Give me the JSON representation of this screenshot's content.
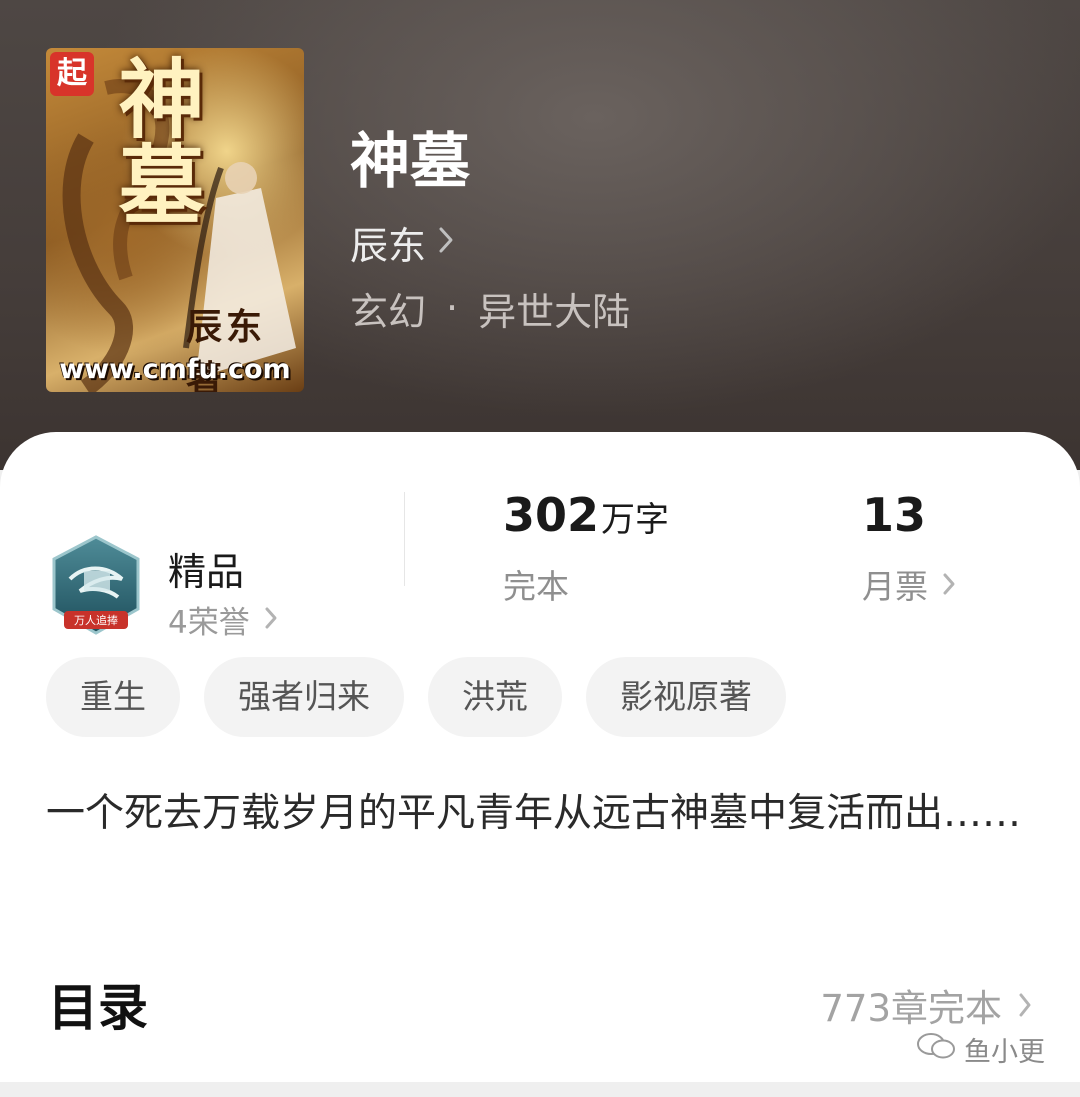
{
  "book": {
    "title": "神墓",
    "author": "辰东",
    "genre": "玄幻",
    "subgenre": "异世大陆",
    "genre_separator": "·"
  },
  "cover": {
    "badge": "起",
    "title": "神墓",
    "author": "辰东著",
    "url": "www.cmfu.com"
  },
  "honor": {
    "name": "精品",
    "count_label": "4荣誉",
    "icon_label": "万人追捧"
  },
  "stats": {
    "word_count": "302",
    "word_unit": "万字",
    "status": "完本",
    "monthly_votes": "13",
    "monthly_votes_label": "月票"
  },
  "tags": [
    "重生",
    "强者归来",
    "洪荒",
    "影视原著"
  ],
  "description": "一个死去万载岁月的平凡青年从远古神墓中复活而出……",
  "toc": {
    "title": "目录",
    "chapter_info": "773章完本"
  },
  "watermark": "鱼小更",
  "colors": {
    "header_bg": "#4a4240",
    "card_bg": "#ffffff",
    "tag_bg": "#f3f3f3",
    "muted_text": "#9a9a9a"
  }
}
